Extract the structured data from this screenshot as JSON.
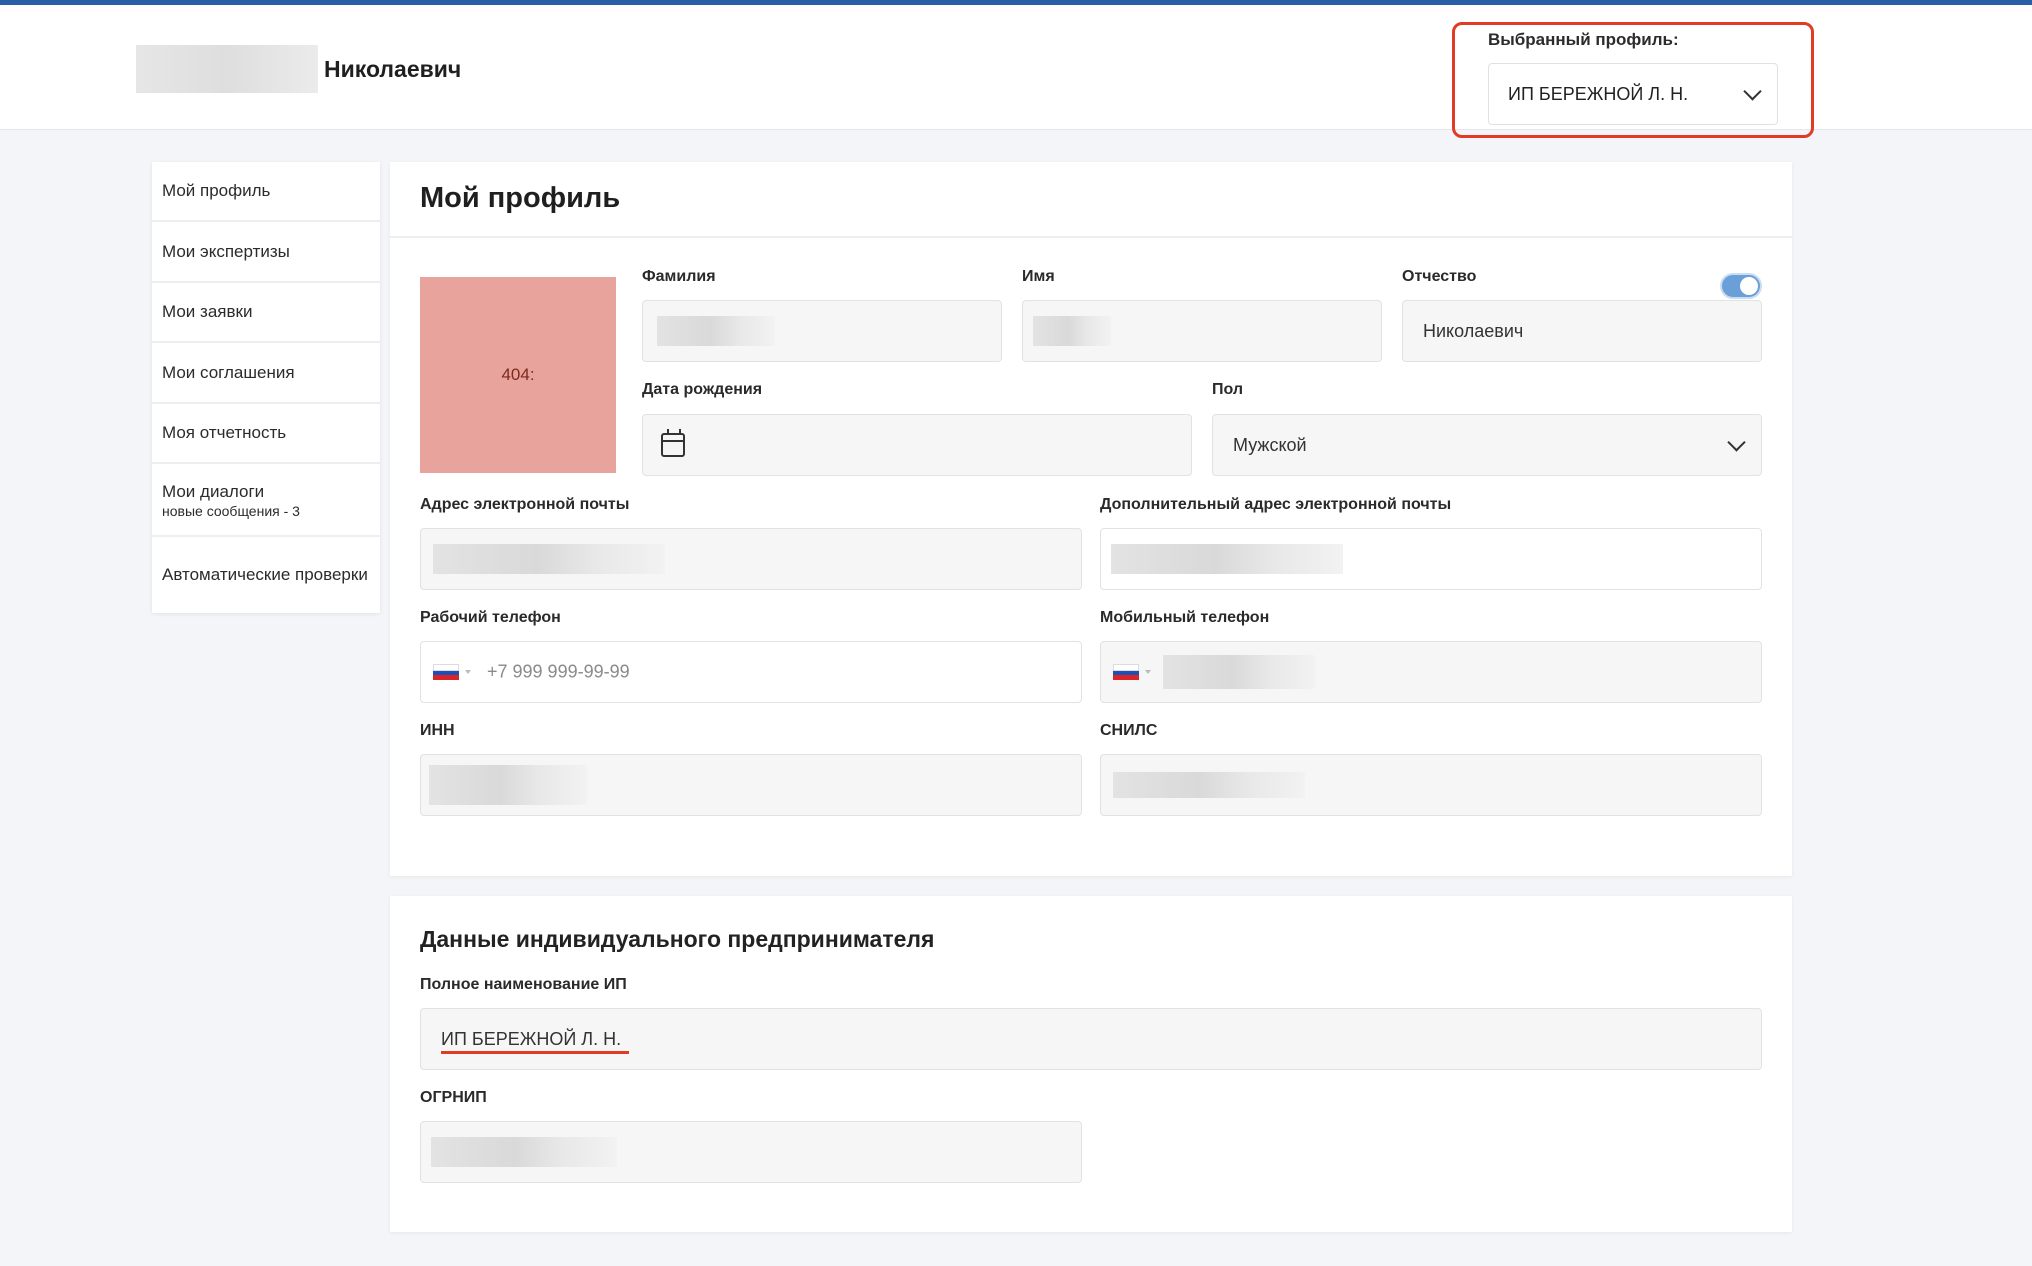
{
  "header": {
    "user_name": "Николаевич",
    "profile_select_label": "Выбранный профиль:",
    "profile_select_value": "ИП БЕРЕЖНОЙ Л. Н."
  },
  "sidebar": {
    "items": [
      {
        "label": "Мой профиль"
      },
      {
        "label": "Мои экспертизы"
      },
      {
        "label": "Мои заявки"
      },
      {
        "label": "Мои соглашения"
      },
      {
        "label": "Моя отчетность"
      },
      {
        "label": "Мои диалоги",
        "sub": "новые сообщения - 3"
      },
      {
        "label": "Автоматические проверки"
      }
    ]
  },
  "profile": {
    "title": "Мой профиль",
    "avatar_text": "404:",
    "surname_label": "Фамилия",
    "name_label": "Имя",
    "patronymic_label": "Отчество",
    "patronymic_value": "Николаевич",
    "patronymic_toggle_on": true,
    "birth_label": "Дата рождения",
    "gender_label": "Пол",
    "gender_value": "Мужской",
    "email_label": "Адрес электронной почты",
    "extra_email_label": "Дополнительный адрес электронной почты",
    "work_phone_label": "Рабочий телефон",
    "work_phone_placeholder": "+7 999 999-99-99",
    "mobile_phone_label": "Мобильный телефон",
    "inn_label": "ИНН",
    "snils_label": "СНИЛС"
  },
  "ip": {
    "title": "Данные индивидуального предпринимателя",
    "full_name_label": "Полное наименование ИП",
    "full_name_value": "ИП БЕРЕЖНОЙ Л. Н.",
    "ogrnip_label": "ОГРНИП"
  },
  "colors": {
    "accent_border": "#2a5fa8",
    "highlight_red": "#e33a25",
    "toggle_on": "#6a9fd8",
    "avatar_bg": "#e8a49c"
  }
}
